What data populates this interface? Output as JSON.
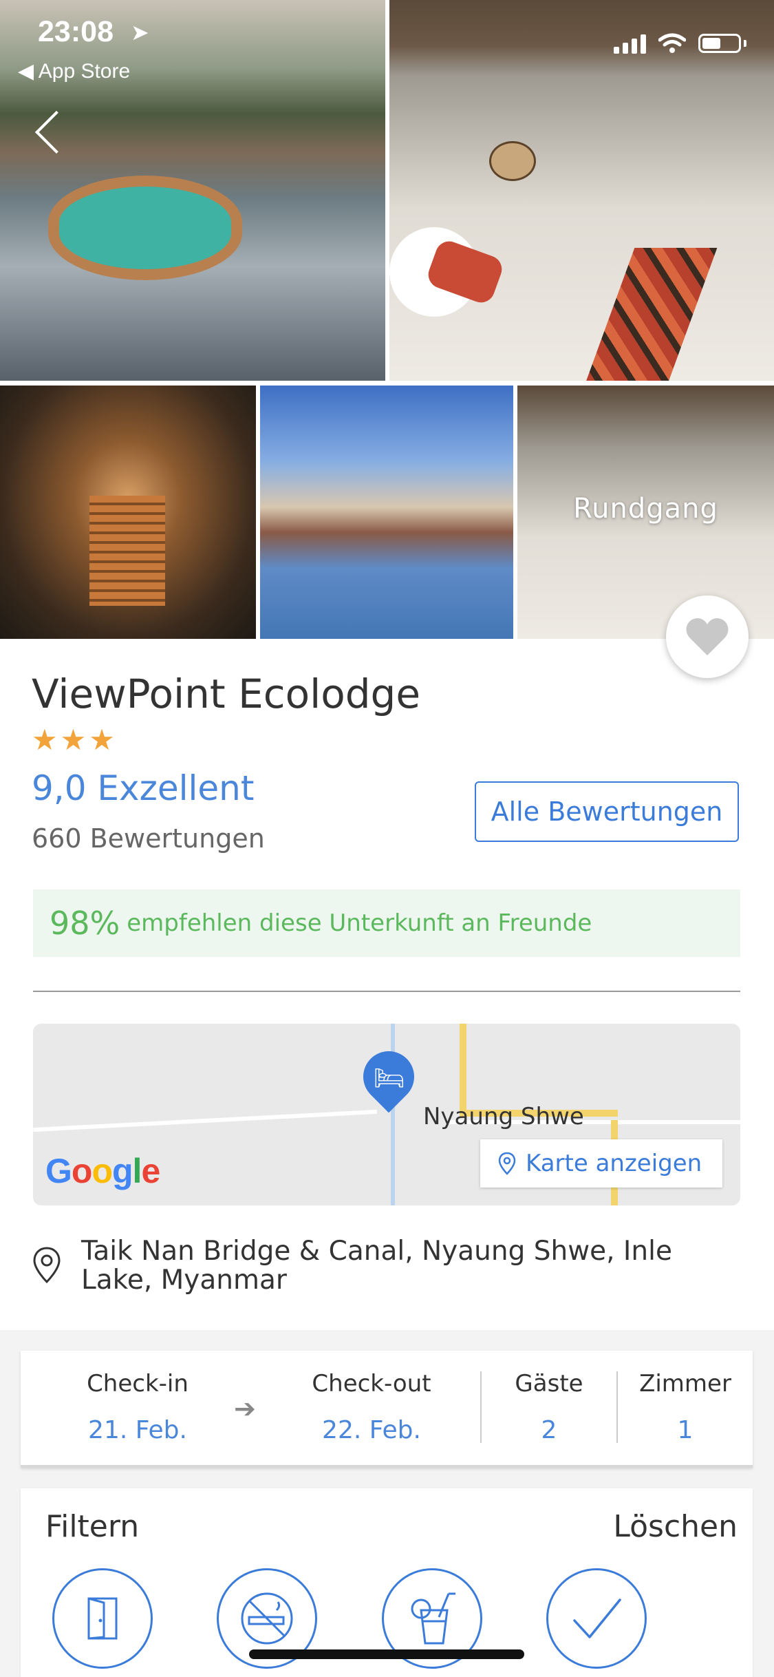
{
  "status_bar": {
    "time": "23:08",
    "back_app": "◀ App Store"
  },
  "gallery": {
    "tour_label": "Rundgang"
  },
  "hotel": {
    "name": "ViewPoint Ecolodge",
    "stars": "★★★",
    "star_count": 3,
    "rating": "9,0 Exzellent",
    "reviews": "660 Bewertungen",
    "all_reviews_button": "Alle Bewertungen",
    "recommend_pct": "98%",
    "recommend_text": "empfehlen diese Unterkunft an Freunde"
  },
  "map": {
    "town_label": "Nyaung Shwe",
    "show_map_button": "Karte anzeigen",
    "provider": "Google"
  },
  "address": "Taik Nan Bridge & Canal, Nyaung Shwe, Inle Lake, Myanmar",
  "booking": {
    "checkin_label": "Check-in",
    "checkin_value": "21. Feb.",
    "checkout_label": "Check-out",
    "checkout_value": "22. Feb.",
    "guests_label": "Gäste",
    "guests_value": "2",
    "rooms_label": "Zimmer",
    "rooms_value": "1"
  },
  "filter": {
    "title": "Filtern",
    "clear": "Löschen",
    "icons": [
      "door-icon",
      "no-smoking-icon",
      "drink-icon",
      "checkmark-icon"
    ]
  },
  "colors": {
    "accent": "#3b7bd9",
    "star": "#f2a33a",
    "recommend_green": "#5cb85c",
    "recommend_bg": "#edf7f0"
  }
}
